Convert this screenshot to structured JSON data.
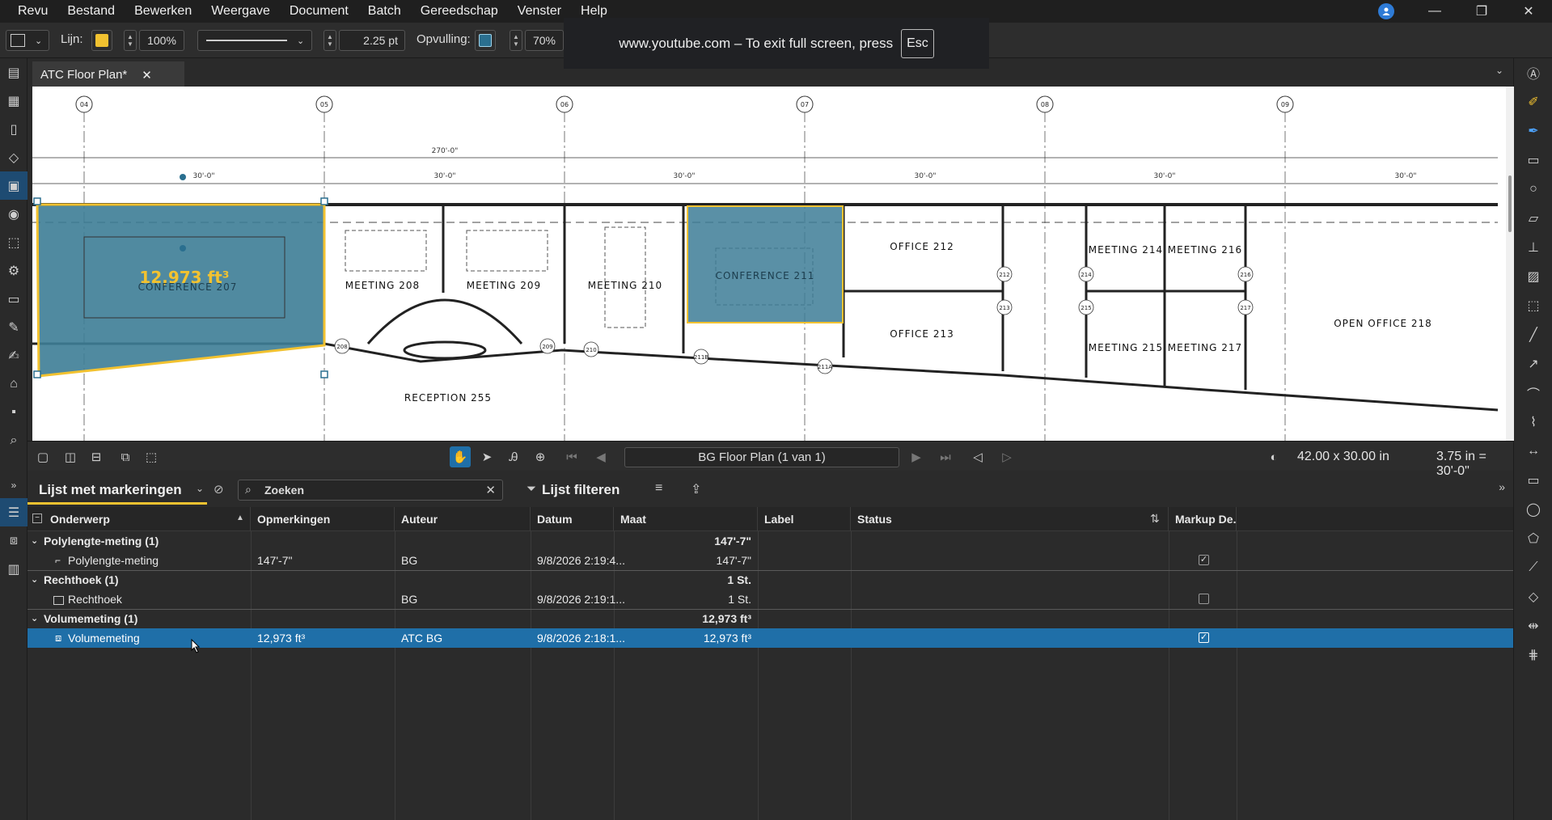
{
  "menubar": {
    "items": [
      "Revu",
      "Bestand",
      "Bewerken",
      "Weergave",
      "Document",
      "Batch",
      "Gereedschap",
      "Venster",
      "Help"
    ]
  },
  "properties_toolbar": {
    "line_label": "Lijn:",
    "line_color": "#f2c230",
    "line_opacity": "100%",
    "line_width": "2.25 pt",
    "fill_label": "Opvulling:",
    "fill_color": "#2a6f8f",
    "fill_opacity": "70%"
  },
  "fullscreen_toast": {
    "text": "www.youtube.com – To exit full screen, press",
    "key": "Esc"
  },
  "document_tab": {
    "title": "ATC Floor Plan*"
  },
  "drawing": {
    "grid_labels": [
      "04",
      "05",
      "06",
      "07",
      "08",
      "09"
    ],
    "overall_dimension": "270'-0\"",
    "bay_dimensions": [
      "30'-0\"",
      "30'-0\"",
      "30'-0\"",
      "30'-0\"",
      "30'-0\"",
      "30'-0\""
    ],
    "measurement_label": "12,973 ft³",
    "rooms": [
      "CONFERENCE 207",
      "MEETING 208",
      "MEETING 209",
      "MEETING 210",
      "CONFERENCE 211",
      "OFFICE 212",
      "OFFICE 213",
      "MEETING 214",
      "MEETING 216",
      "MEETING 215",
      "MEETING 217",
      "OPEN OFFICE 218",
      "RECEPTION 255"
    ],
    "door_tags": [
      "208",
      "209",
      "210",
      "211B",
      "211A",
      "212",
      "213",
      "214",
      "215",
      "216",
      "217"
    ],
    "highlight_color": "#3d7d96",
    "outline_color": "#f2c230"
  },
  "view_toolbar": {
    "page_label": "BG Floor Plan (1 van 1)",
    "page_size": "42.00 x 30.00 in",
    "scale": "3.75 in = 30'-0\""
  },
  "markups_panel": {
    "title": "Lijst met markeringen",
    "search_placeholder": "Zoeken",
    "filter_label": "Lijst filteren",
    "columns": [
      "Onderwerp",
      "Opmerkingen",
      "Auteur",
      "Datum",
      "Maat",
      "Label",
      "Status",
      "Markup De..."
    ],
    "groups": [
      {
        "title": "Polylengte-meting (1)",
        "total": "147'-7\"",
        "item": {
          "subject": "Polylengte-meting",
          "comments": "147'-7\"",
          "author": "BG",
          "date": "9/8/2026 2:19:4...",
          "measure": "147'-7\"",
          "checked": true
        }
      },
      {
        "title": "Rechthoek (1)",
        "total": "1 St.",
        "item": {
          "subject": "Rechthoek",
          "comments": "",
          "author": "BG",
          "date": "9/8/2026 2:19:1...",
          "measure": "1 St.",
          "checked": false
        }
      },
      {
        "title": "Volumemeting (1)",
        "total": "12,973 ft³",
        "item": {
          "subject": "Volumemeting",
          "comments": "12,973 ft³",
          "author": "ATC BG",
          "date": "9/8/2026 2:18:1...",
          "measure": "12,973 ft³",
          "checked": true
        }
      }
    ],
    "selection_color": "#1f6fa8"
  }
}
